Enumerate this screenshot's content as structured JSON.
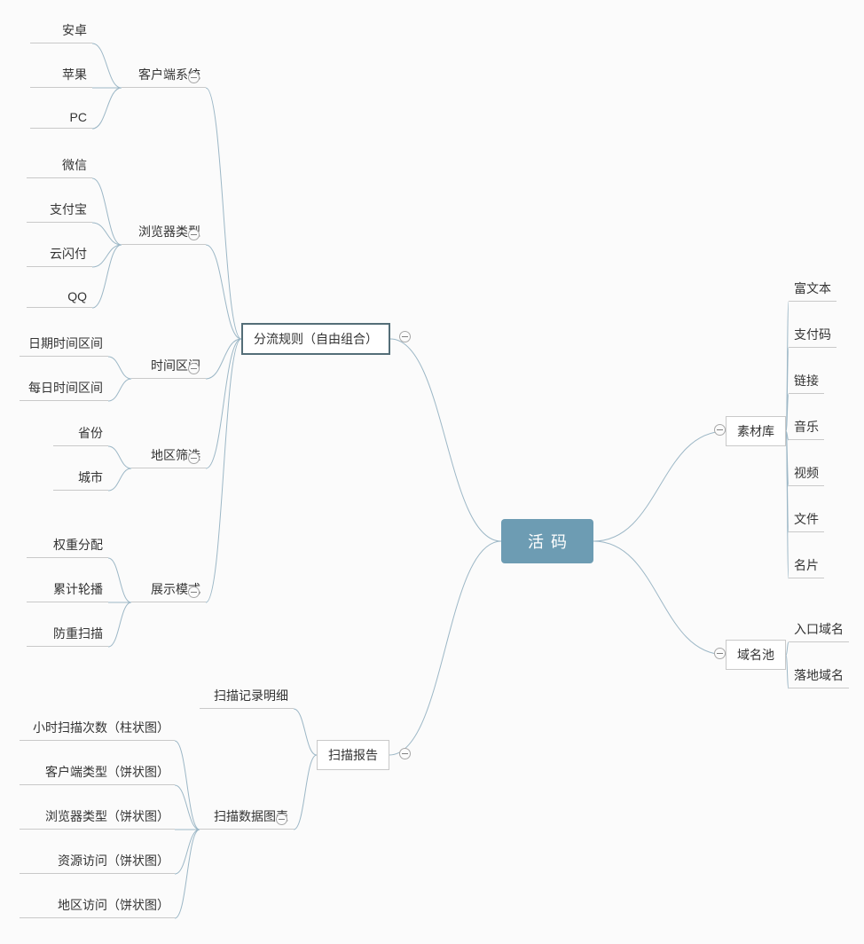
{
  "root": {
    "label": "活码"
  },
  "right": {
    "material": {
      "label": "素材库",
      "children": [
        "富文本",
        "支付码",
        "链接",
        "音乐",
        "视频",
        "文件",
        "名片"
      ]
    },
    "domain": {
      "label": "域名池",
      "children": [
        "入口域名",
        "落地域名"
      ]
    }
  },
  "left": {
    "rules": {
      "label": "分流规则（自由组合）",
      "children": {
        "os": {
          "label": "客户端系统",
          "children": [
            "安卓",
            "苹果",
            "PC"
          ]
        },
        "browser": {
          "label": "浏览器类型",
          "children": [
            "微信",
            "支付宝",
            "云闪付",
            "QQ"
          ]
        },
        "time": {
          "label": "时间区间",
          "children": [
            "日期时间区间",
            "每日时间区间"
          ]
        },
        "region": {
          "label": "地区筛选",
          "children": [
            "省份",
            "城市"
          ]
        },
        "display": {
          "label": "展示模式",
          "children": [
            "权重分配",
            "累计轮播",
            "防重扫描"
          ]
        }
      }
    },
    "report": {
      "label": "扫描报告",
      "children": {
        "detail": {
          "label": "扫描记录明细"
        },
        "charts": {
          "label": "扫描数据图表",
          "children": [
            "小时扫描次数（柱状图）",
            "客户端类型（饼状图）",
            "浏览器类型（饼状图）",
            "资源访问（饼状图）",
            "地区访问（饼状图）"
          ]
        }
      }
    }
  }
}
